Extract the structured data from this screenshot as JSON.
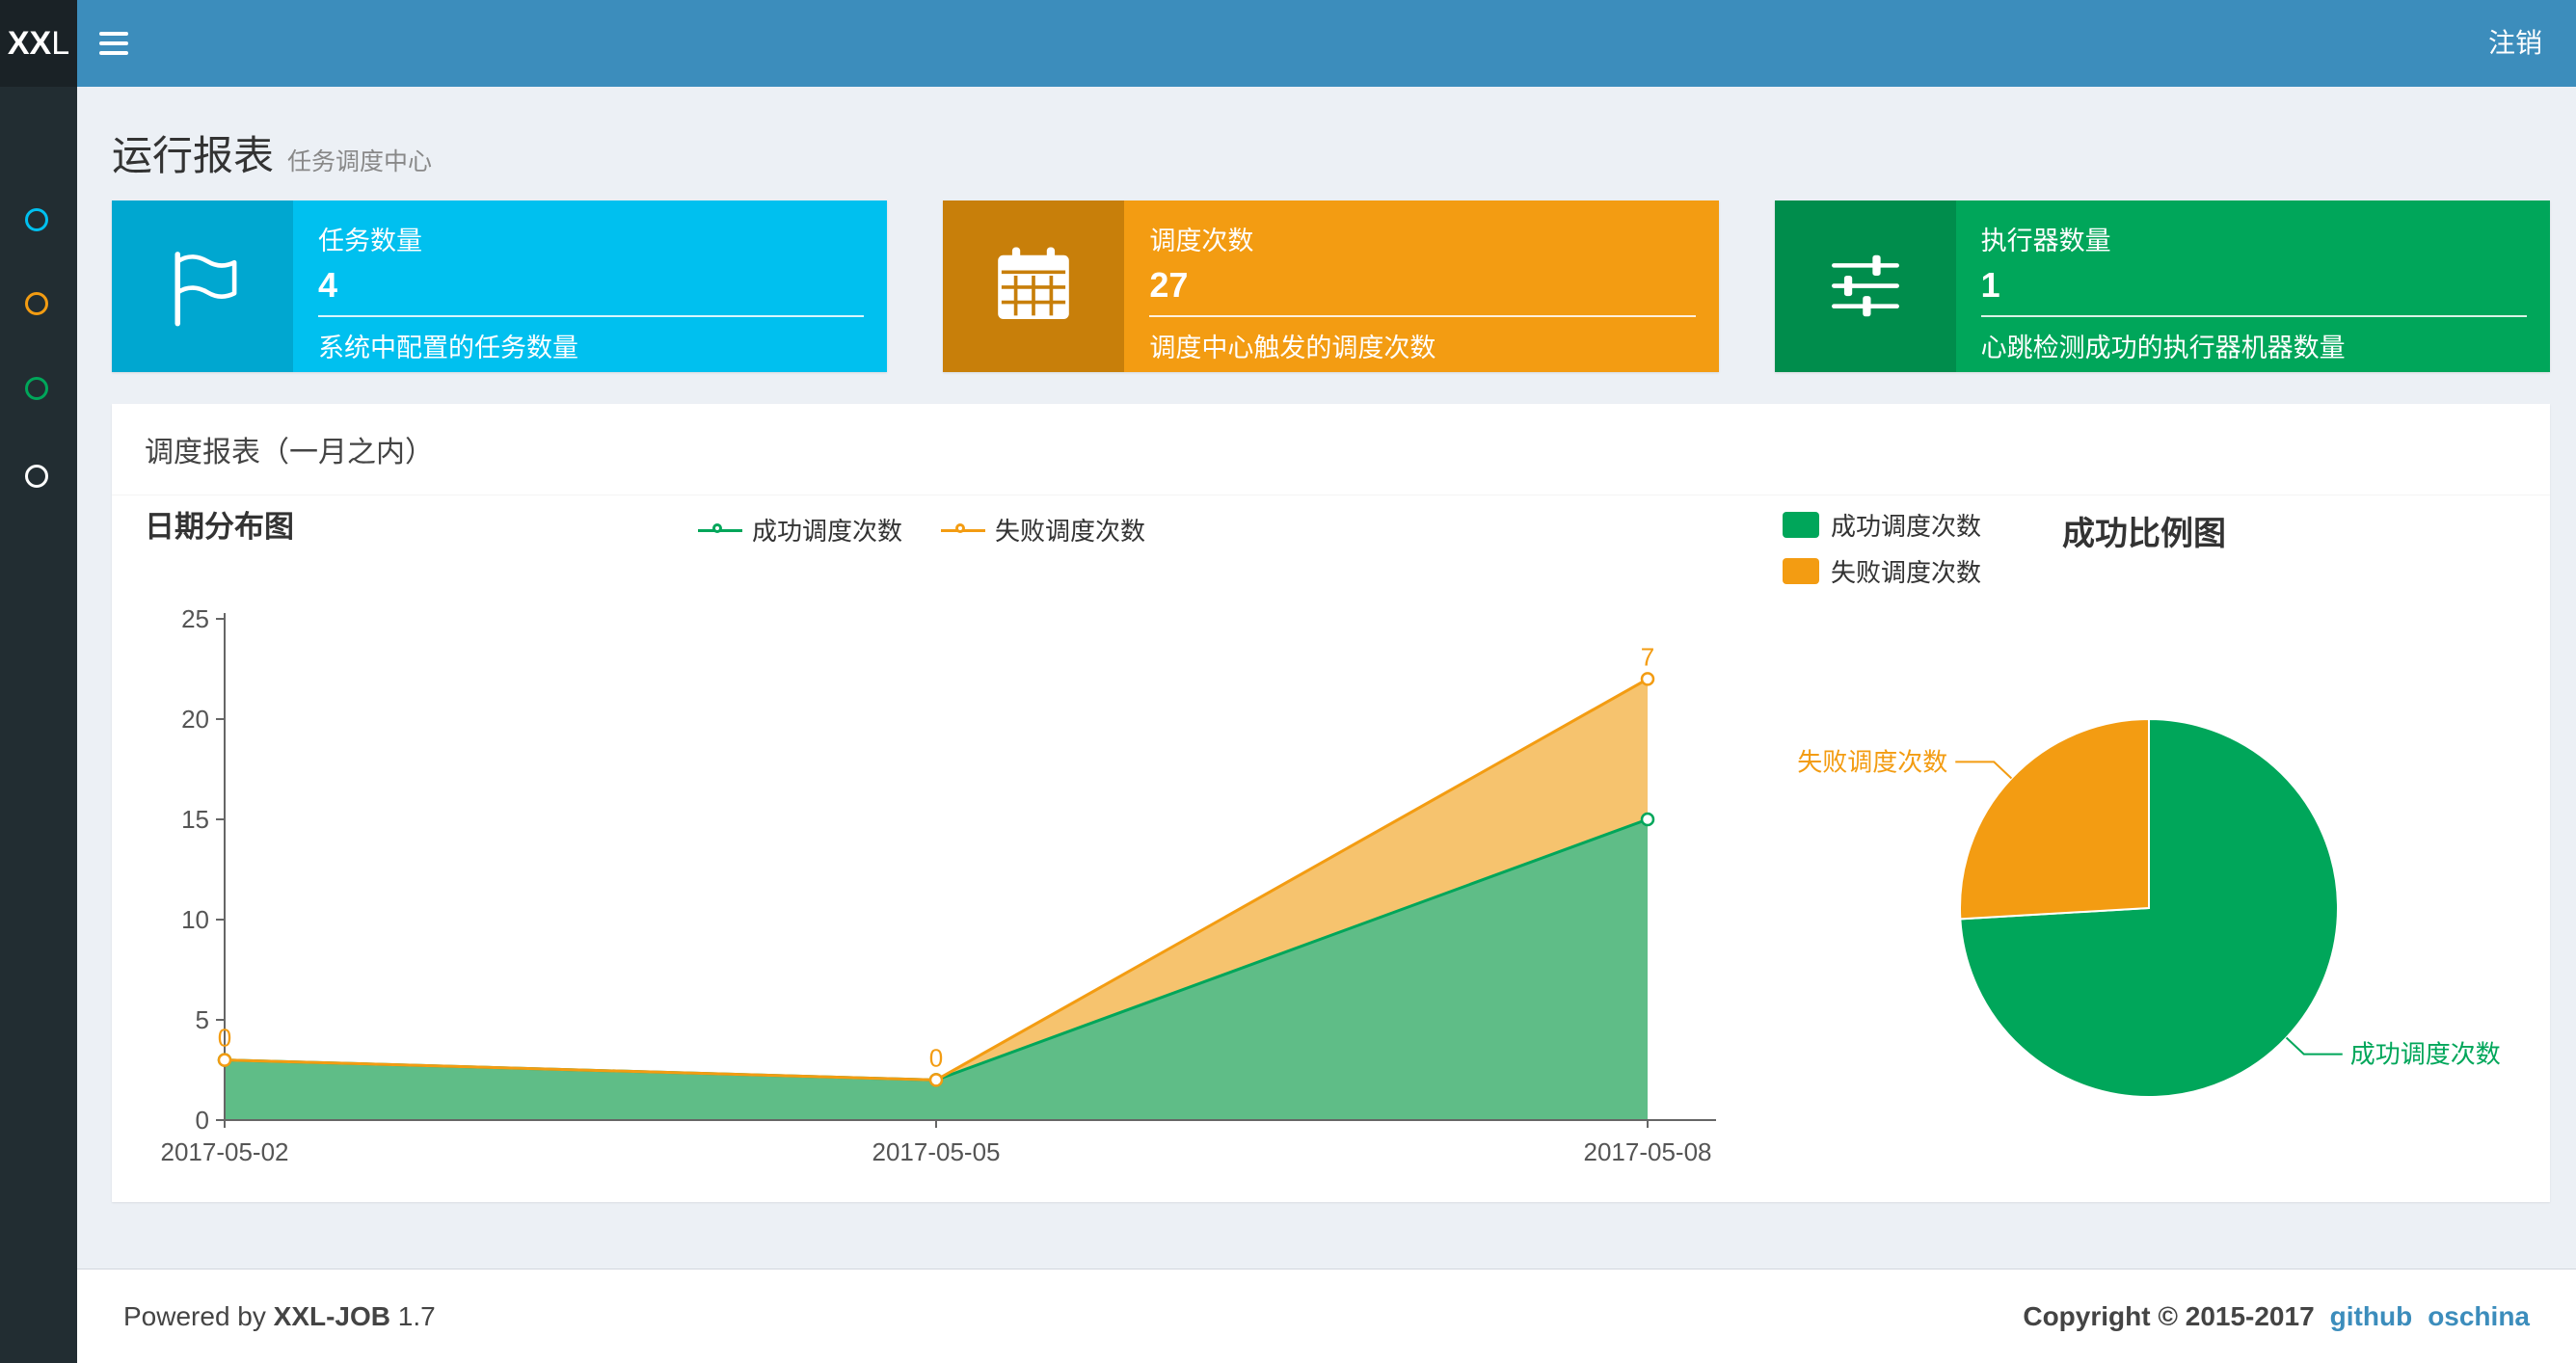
{
  "navbar": {
    "logo_bold": "XX",
    "logo_light": "L",
    "menu_icon": "hamburger-icon",
    "logout_label": "注销"
  },
  "sidebar": {
    "items": [
      {
        "icon": "circle-icon",
        "color": "#00c0ef"
      },
      {
        "icon": "circle-icon",
        "color": "#f39c12"
      },
      {
        "icon": "circle-icon",
        "color": "#00a65a"
      },
      {
        "icon": "circle-icon",
        "color": "#ffffff"
      }
    ]
  },
  "header": {
    "title": "运行报表",
    "subtitle": "任务调度中心"
  },
  "info_boxes": [
    {
      "title": "任务数量",
      "value": "4",
      "desc": "系统中配置的任务数量",
      "bg": "#00c0ef",
      "icon_bg": "#00a7d0",
      "icon": "flag-icon"
    },
    {
      "title": "调度次数",
      "value": "27",
      "desc": "调度中心触发的调度次数",
      "bg": "#f39c12",
      "icon_bg": "#c87f0a",
      "icon": "calendar-icon"
    },
    {
      "title": "执行器数量",
      "value": "1",
      "desc": "心跳检测成功的执行器机器数量",
      "bg": "#00a65a",
      "icon_bg": "#008d4c",
      "icon": "sliders-icon"
    }
  ],
  "panel": {
    "title": "调度报表（一月之内）"
  },
  "chart_data": [
    {
      "type": "area",
      "title": "日期分布图",
      "stacked": true,
      "x": [
        "2017-05-02",
        "2017-05-05",
        "2017-05-08"
      ],
      "series": [
        {
          "name": "成功调度次数",
          "values": [
            3,
            2,
            15
          ],
          "color": "#00a65a",
          "fill": "#5fbd87"
        },
        {
          "name": "失败调度次数",
          "values": [
            0,
            0,
            7
          ],
          "color": "#f39c12",
          "fill": "#f6c36e",
          "labels": [
            "0",
            "0",
            "7"
          ]
        }
      ],
      "ylim": [
        0,
        25
      ],
      "yticks": [
        0,
        5,
        10,
        15,
        20,
        25
      ],
      "legend_position": "top-center",
      "grid": false,
      "axis_color": "#666666",
      "tick_label_color": "#555555"
    },
    {
      "type": "pie",
      "title": "成功比例图",
      "slices": [
        {
          "name": "成功调度次数",
          "value": 20,
          "color": "#00a65a",
          "label_side": "right"
        },
        {
          "name": "失败调度次数",
          "value": 7,
          "color": "#f39c12",
          "label_side": "left"
        }
      ],
      "legend_position": "top-left"
    }
  ],
  "footer": {
    "powered_prefix": "Powered by",
    "brand": "XXL-JOB",
    "version": "1.7",
    "copyright": "Copyright © 2015-2017",
    "links": [
      {
        "label": "github"
      },
      {
        "label": "oschina"
      }
    ]
  }
}
